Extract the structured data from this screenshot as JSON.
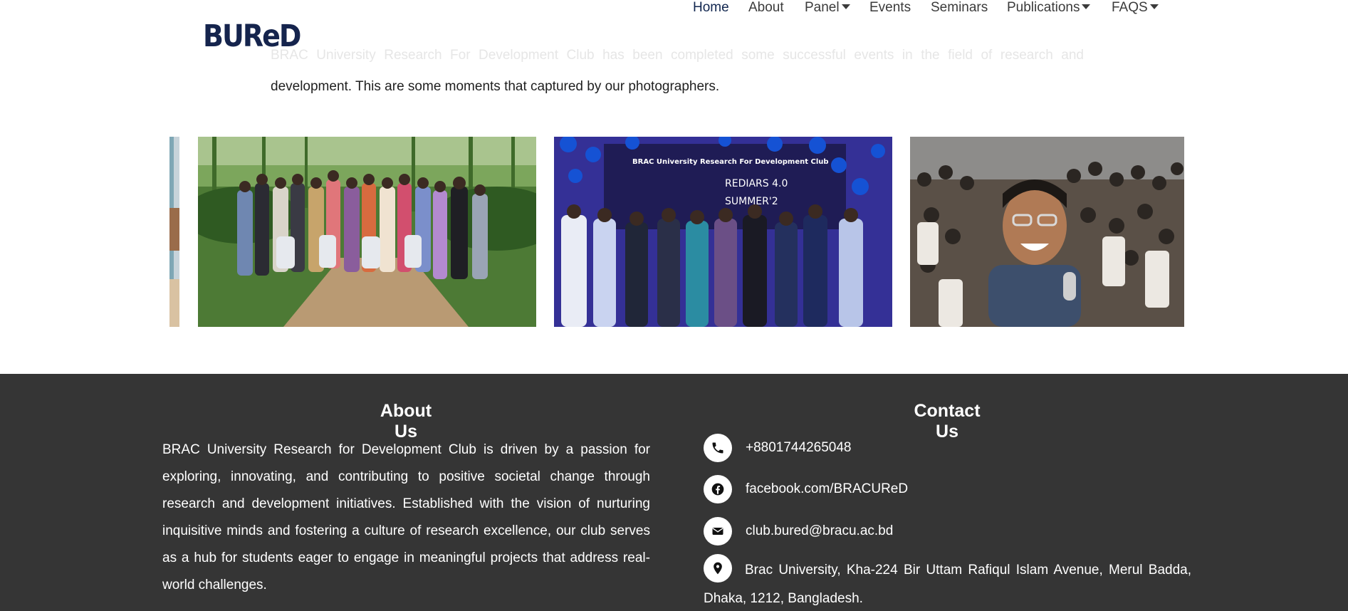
{
  "brand": {
    "logo_text": "BUReD",
    "logo_color": "#15244d"
  },
  "nav": {
    "items": [
      {
        "label": "Home",
        "active": true
      },
      {
        "label": "About"
      },
      {
        "label": "Panel",
        "dropdown": true
      },
      {
        "label": "Events"
      },
      {
        "label": "Seminars"
      },
      {
        "label": "Publications",
        "dropdown": true
      },
      {
        "label": "FAQS",
        "dropdown": true
      }
    ]
  },
  "intro": {
    "faded_text": "BRAC University Research For Development Club has been completed some successful events in the field of research and",
    "text": "development. This are some moments that captured by our photographers."
  },
  "gallery": {
    "photos": [
      {
        "icon": "group-photo-tea-garden-icon"
      },
      {
        "icon": "stage-event-rediars-icon"
      },
      {
        "icon": "selfie-crowd-photo-icon"
      }
    ],
    "stage_banner": {
      "heading": "BRAC University Research For Development Club",
      "event": "REDIARS 4.0",
      "season": "SUMMER'2"
    }
  },
  "footer": {
    "background": "#353535",
    "about": {
      "title": "About Us",
      "text": "BRAC University Research for Development Club is driven by a passion for exploring, innovating, and contributing to positive societal change through research and development initiatives. Established with the vision of nurturing inquisitive minds and fostering a culture of research excellence, our club serves as a hub for students eager to engage in meaningful projects that address real-world challenges."
    },
    "contact": {
      "title": "Contact Us",
      "phone": "+8801744265048",
      "facebook": "facebook.com/BRACUReD",
      "email": "club.bured@bracu.ac.bd",
      "address": "Brac University, Kha-224 Bir Uttam Rafiqul Islam Avenue, Merul Badda, Dhaka, 1212, Bangladesh."
    }
  }
}
